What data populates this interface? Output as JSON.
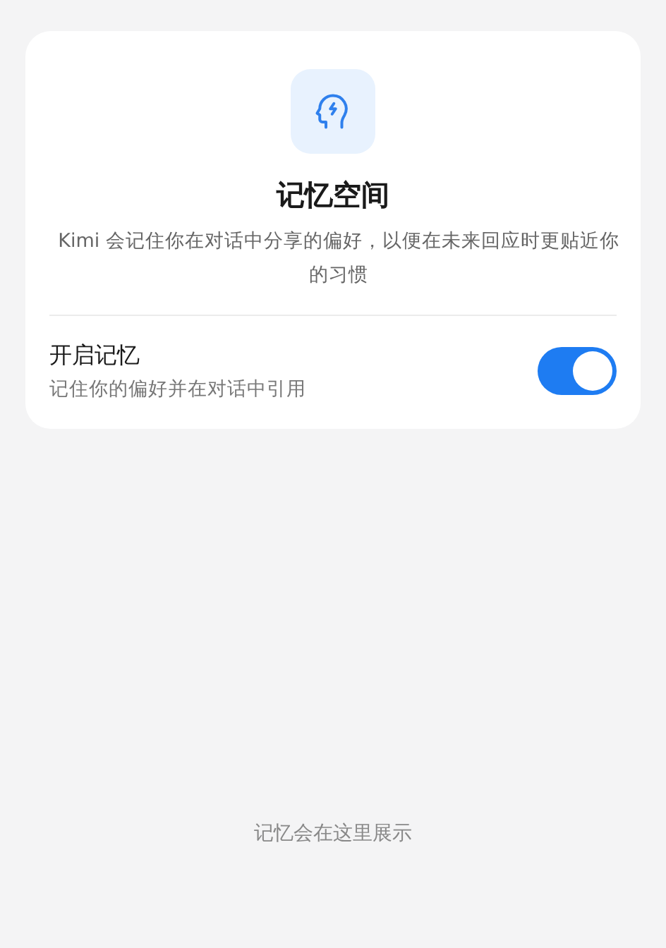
{
  "header": {
    "title": "记忆空间",
    "description": "Kimi 会记住你在对话中分享的偏好，以便在未来回应时更贴近你的习惯"
  },
  "setting": {
    "label": "开启记忆",
    "hint": "记住你的偏好并在对话中引用",
    "on": true
  },
  "empty_state": "记忆会在这里展示"
}
